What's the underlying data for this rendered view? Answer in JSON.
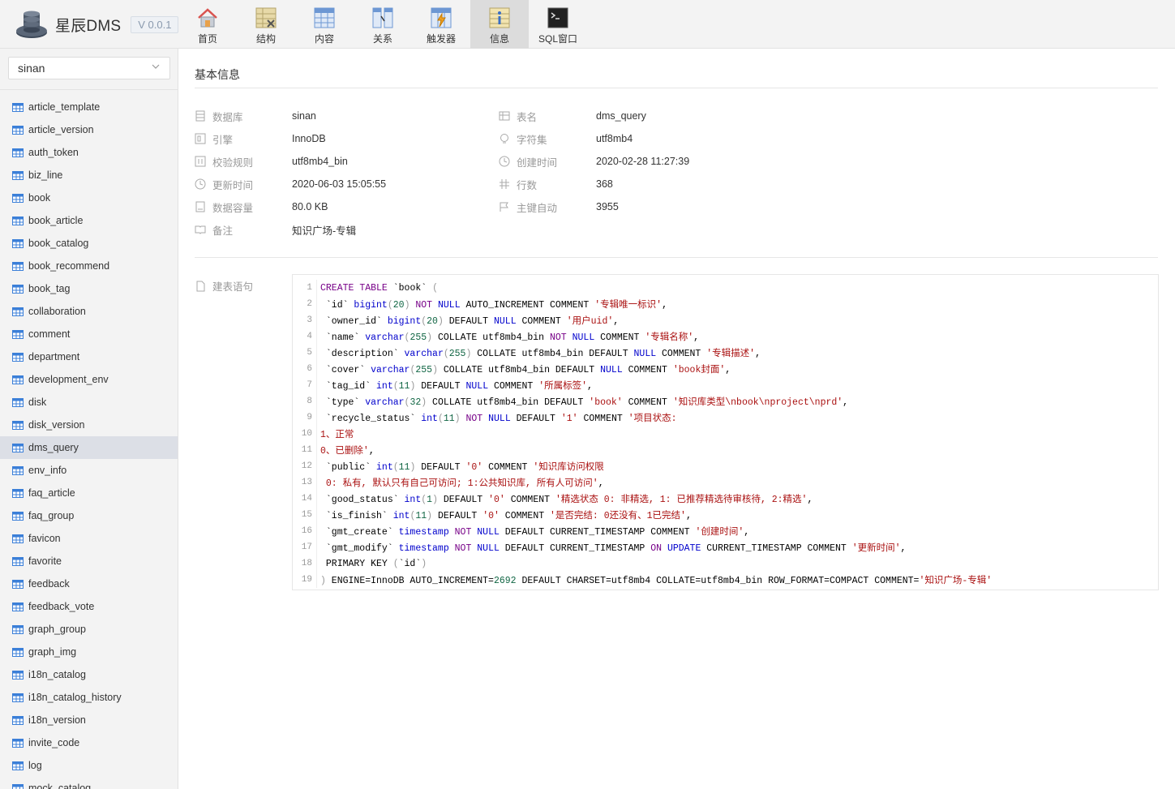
{
  "app": {
    "name": "星辰DMS",
    "version": "V 0.0.1"
  },
  "nav": [
    {
      "label": "首页",
      "icon": "home-icon"
    },
    {
      "label": "结构",
      "icon": "structure-icon"
    },
    {
      "label": "内容",
      "icon": "content-icon"
    },
    {
      "label": "关系",
      "icon": "relation-icon"
    },
    {
      "label": "触发器",
      "icon": "trigger-icon"
    },
    {
      "label": "信息",
      "icon": "info-icon",
      "active": true
    },
    {
      "label": "SQL窗口",
      "icon": "sql-terminal-icon"
    }
  ],
  "sidebar": {
    "database": "sinan",
    "tables": [
      "article_template",
      "article_version",
      "auth_token",
      "biz_line",
      "book",
      "book_article",
      "book_catalog",
      "book_recommend",
      "book_tag",
      "collaboration",
      "comment",
      "department",
      "development_env",
      "disk",
      "disk_version",
      "dms_query",
      "env_info",
      "faq_article",
      "faq_group",
      "favicon",
      "favorite",
      "feedback",
      "feedback_vote",
      "graph_group",
      "graph_img",
      "i18n_catalog",
      "i18n_catalog_history",
      "i18n_version",
      "invite_code",
      "log",
      "mock_catalog"
    ],
    "active_table": "dms_query"
  },
  "main": {
    "section_title": "基本信息",
    "fields": {
      "database": {
        "label": "数据库",
        "value": "sinan"
      },
      "table_name": {
        "label": "表名",
        "value": "dms_query"
      },
      "engine": {
        "label": "引擎",
        "value": "InnoDB"
      },
      "charset": {
        "label": "字符集",
        "value": "utf8mb4"
      },
      "collation": {
        "label": "校验规则",
        "value": "utf8mb4_bin"
      },
      "created": {
        "label": "创建时间",
        "value": "2020-02-28 11:27:39"
      },
      "updated": {
        "label": "更新时间",
        "value": "2020-06-03 15:05:55"
      },
      "rows": {
        "label": "行数",
        "value": "368"
      },
      "size": {
        "label": "数据容量",
        "value": "80.0 KB"
      },
      "auto_increment": {
        "label": "主键自动",
        "value": "3955"
      },
      "comment": {
        "label": "备注",
        "value": "知识广场-专辑"
      }
    },
    "ddl_label": "建表语句",
    "ddl_lines": [
      [
        [
          "k",
          "CREATE"
        ],
        [
          "",
          ""
        ],
        [
          "k",
          " TABLE"
        ],
        [
          "",
          " `book` "
        ],
        [
          "pu",
          "("
        ]
      ],
      [
        [
          "",
          " `id` "
        ],
        [
          "ty",
          "bigint"
        ],
        [
          "pu",
          "("
        ],
        [
          "nu",
          "20"
        ],
        [
          "pu",
          ")"
        ],
        [
          "",
          " "
        ],
        [
          "k",
          "NOT"
        ],
        [
          "",
          " "
        ],
        [
          "ty",
          "NULL"
        ],
        [
          "",
          " AUTO_INCREMENT COMMENT "
        ],
        [
          "st",
          "'专辑唯一标识'"
        ],
        [
          "",
          ","
        ]
      ],
      [
        [
          "",
          " `owner_id` "
        ],
        [
          "ty",
          "bigint"
        ],
        [
          "pu",
          "("
        ],
        [
          "nu",
          "20"
        ],
        [
          "pu",
          ")"
        ],
        [
          "",
          " DEFAULT "
        ],
        [
          "ty",
          "NULL"
        ],
        [
          "",
          " COMMENT "
        ],
        [
          "st",
          "'用户uid'"
        ],
        [
          "",
          ","
        ]
      ],
      [
        [
          "",
          " `name` "
        ],
        [
          "ty",
          "varchar"
        ],
        [
          "pu",
          "("
        ],
        [
          "nu",
          "255"
        ],
        [
          "pu",
          ")"
        ],
        [
          "",
          " COLLATE utf8mb4_bin "
        ],
        [
          "k",
          "NOT"
        ],
        [
          "",
          " "
        ],
        [
          "ty",
          "NULL"
        ],
        [
          "",
          " COMMENT "
        ],
        [
          "st",
          "'专辑名称'"
        ],
        [
          "",
          ","
        ]
      ],
      [
        [
          "",
          " `description` "
        ],
        [
          "ty",
          "varchar"
        ],
        [
          "pu",
          "("
        ],
        [
          "nu",
          "255"
        ],
        [
          "pu",
          ")"
        ],
        [
          "",
          " COLLATE utf8mb4_bin DEFAULT "
        ],
        [
          "ty",
          "NULL"
        ],
        [
          "",
          " COMMENT "
        ],
        [
          "st",
          "'专辑描述'"
        ],
        [
          "",
          ","
        ]
      ],
      [
        [
          "",
          " `cover` "
        ],
        [
          "ty",
          "varchar"
        ],
        [
          "pu",
          "("
        ],
        [
          "nu",
          "255"
        ],
        [
          "pu",
          ")"
        ],
        [
          "",
          " COLLATE utf8mb4_bin DEFAULT "
        ],
        [
          "ty",
          "NULL"
        ],
        [
          "",
          " COMMENT "
        ],
        [
          "st",
          "'book封面'"
        ],
        [
          "",
          ","
        ]
      ],
      [
        [
          "",
          " `tag_id` "
        ],
        [
          "ty",
          "int"
        ],
        [
          "pu",
          "("
        ],
        [
          "nu",
          "11"
        ],
        [
          "pu",
          ")"
        ],
        [
          "",
          " DEFAULT "
        ],
        [
          "ty",
          "NULL"
        ],
        [
          "",
          " COMMENT "
        ],
        [
          "st",
          "'所属标签'"
        ],
        [
          "",
          ","
        ]
      ],
      [
        [
          "",
          " `type` "
        ],
        [
          "ty",
          "varchar"
        ],
        [
          "pu",
          "("
        ],
        [
          "nu",
          "32"
        ],
        [
          "pu",
          ")"
        ],
        [
          "",
          " COLLATE utf8mb4_bin DEFAULT "
        ],
        [
          "st",
          "'book'"
        ],
        [
          "",
          " COMMENT "
        ],
        [
          "st",
          "'知识库类型\\nbook\\nproject\\nprd'"
        ],
        [
          "",
          ","
        ]
      ],
      [
        [
          "",
          " `recycle_status` "
        ],
        [
          "ty",
          "int"
        ],
        [
          "pu",
          "("
        ],
        [
          "nu",
          "11"
        ],
        [
          "pu",
          ")"
        ],
        [
          "",
          " "
        ],
        [
          "k",
          "NOT"
        ],
        [
          "",
          " "
        ],
        [
          "ty",
          "NULL"
        ],
        [
          "",
          " DEFAULT "
        ],
        [
          "st",
          "'1'"
        ],
        [
          "",
          " COMMENT "
        ],
        [
          "st",
          "'项目状态:"
        ]
      ],
      [
        [
          "st",
          "1、正常"
        ]
      ],
      [
        [
          "st",
          "0、已删除'"
        ],
        [
          "",
          ","
        ]
      ],
      [
        [
          "",
          " `public` "
        ],
        [
          "ty",
          "int"
        ],
        [
          "pu",
          "("
        ],
        [
          "nu",
          "11"
        ],
        [
          "pu",
          ")"
        ],
        [
          "",
          " DEFAULT "
        ],
        [
          "st",
          "'0'"
        ],
        [
          "",
          " COMMENT "
        ],
        [
          "st",
          "'知识库访问权限"
        ]
      ],
      [
        [
          "st",
          " 0: 私有, 默认只有自己可访问; 1:公共知识库, 所有人可访问'"
        ],
        [
          "",
          ","
        ]
      ],
      [
        [
          "",
          " `good_status` "
        ],
        [
          "ty",
          "int"
        ],
        [
          "pu",
          "("
        ],
        [
          "nu",
          "1"
        ],
        [
          "pu",
          ")"
        ],
        [
          "",
          " DEFAULT "
        ],
        [
          "st",
          "'0'"
        ],
        [
          "",
          " COMMENT "
        ],
        [
          "st",
          "'精选状态 0: 非精选, 1: 已推荐精选待审核待, 2:精选'"
        ],
        [
          "",
          ","
        ]
      ],
      [
        [
          "",
          " `is_finish` "
        ],
        [
          "ty",
          "int"
        ],
        [
          "pu",
          "("
        ],
        [
          "nu",
          "11"
        ],
        [
          "pu",
          ")"
        ],
        [
          "",
          " DEFAULT "
        ],
        [
          "st",
          "'0'"
        ],
        [
          "",
          " COMMENT "
        ],
        [
          "st",
          "'是否完结: 0还没有、1已完结'"
        ],
        [
          "",
          ","
        ]
      ],
      [
        [
          "",
          " `gmt_create` "
        ],
        [
          "ty",
          "timestamp"
        ],
        [
          "",
          " "
        ],
        [
          "k",
          "NOT"
        ],
        [
          "",
          " "
        ],
        [
          "ty",
          "NULL"
        ],
        [
          "",
          " DEFAULT CURRENT_TIMESTAMP COMMENT "
        ],
        [
          "st",
          "'创建时间'"
        ],
        [
          "",
          ","
        ]
      ],
      [
        [
          "",
          " `gmt_modify` "
        ],
        [
          "ty",
          "timestamp"
        ],
        [
          "",
          " "
        ],
        [
          "k",
          "NOT"
        ],
        [
          "",
          " "
        ],
        [
          "ty",
          "NULL"
        ],
        [
          "",
          " DEFAULT CURRENT_TIMESTAMP "
        ],
        [
          "k",
          "ON"
        ],
        [
          "",
          " "
        ],
        [
          "ty",
          "UPDATE"
        ],
        [
          "",
          " CURRENT_TIMESTAMP COMMENT "
        ],
        [
          "st",
          "'更新时间'"
        ],
        [
          "",
          ","
        ]
      ],
      [
        [
          "",
          " PRIMARY KEY "
        ],
        [
          "pu",
          "("
        ],
        [
          "",
          "`id`"
        ],
        [
          "pu",
          ")"
        ]
      ],
      [
        [
          "pu",
          ")"
        ],
        [
          "",
          " ENGINE=InnoDB AUTO_INCREMENT="
        ],
        [
          "nu",
          "2692"
        ],
        [
          "",
          " DEFAULT CHARSET=utf8mb4 COLLATE=utf8mb4_bin ROW_FORMAT=COMPACT COMMENT="
        ],
        [
          "st",
          "'知识广场-专辑'"
        ]
      ]
    ]
  },
  "colors": {
    "keyword": "#770088",
    "type": "#0000cc",
    "number": "#116644",
    "string": "#aa1111",
    "active_nav": "#dcdcdc",
    "table_icon": "#3b7fd8"
  }
}
